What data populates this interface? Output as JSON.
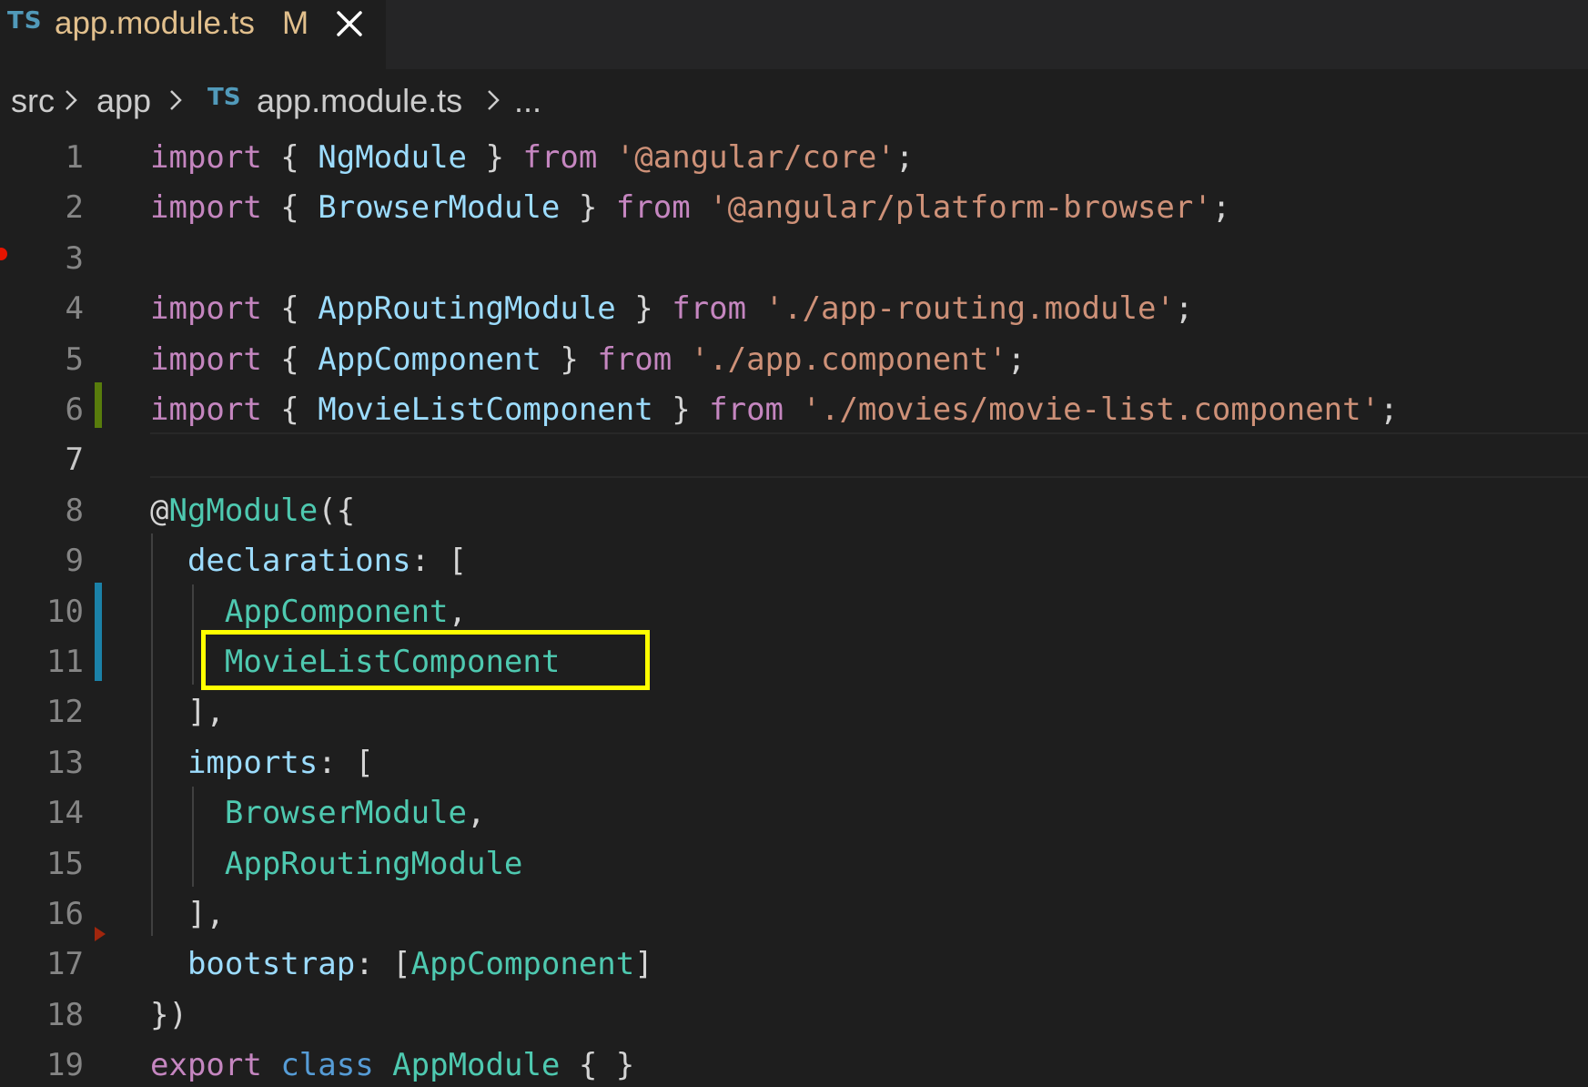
{
  "tab": {
    "icon_label": "TS",
    "filename": "app.module.ts",
    "status": "M"
  },
  "breadcrumb": {
    "items": [
      "src",
      "app",
      "app.module.ts",
      "..."
    ],
    "file_icon_label": "TS"
  },
  "editor": {
    "active_line": 7,
    "lines": [
      {
        "n": "1"
      },
      {
        "n": "2"
      },
      {
        "n": "3"
      },
      {
        "n": "4"
      },
      {
        "n": "5"
      },
      {
        "n": "6"
      },
      {
        "n": "7"
      },
      {
        "n": "8"
      },
      {
        "n": "9"
      },
      {
        "n": "10"
      },
      {
        "n": "11"
      },
      {
        "n": "12"
      },
      {
        "n": "13"
      },
      {
        "n": "14"
      },
      {
        "n": "15"
      },
      {
        "n": "16"
      },
      {
        "n": "17"
      },
      {
        "n": "18"
      },
      {
        "n": "19"
      }
    ],
    "tokens": {
      "l1": [
        "import",
        " { ",
        "NgModule",
        " } ",
        "from",
        " ",
        "'@angular/core'",
        ";"
      ],
      "l2": [
        "import",
        " { ",
        "BrowserModule",
        " } ",
        "from",
        " ",
        "'@angular/platform-browser'",
        ";"
      ],
      "l4": [
        "import",
        " { ",
        "AppRoutingModule",
        " } ",
        "from",
        " ",
        "'./app-routing.module'",
        ";"
      ],
      "l5": [
        "import",
        " { ",
        "AppComponent",
        " } ",
        "from",
        " ",
        "'./app.component'",
        ";"
      ],
      "l6": [
        "import",
        " { ",
        "MovieListComponent",
        " } ",
        "from",
        " ",
        "'./movies/movie-list.component'",
        ";"
      ],
      "l8": [
        "@",
        "NgModule",
        "({"
      ],
      "l9": [
        "  ",
        "declarations",
        ": ["
      ],
      "l10": [
        "    ",
        "AppComponent",
        ","
      ],
      "l11": [
        "    ",
        "MovieListComponent"
      ],
      "l12": [
        "  ",
        "],"
      ],
      "l13": [
        "  ",
        "imports",
        ": ["
      ],
      "l14": [
        "    ",
        "BrowserModule",
        ","
      ],
      "l15": [
        "    ",
        "AppRoutingModule"
      ],
      "l16": [
        "  ",
        "],"
      ],
      "l17": [
        "  ",
        "bootstrap",
        ": [",
        "AppComponent",
        "]"
      ],
      "l18": [
        "})"
      ],
      "l19": [
        "export",
        " ",
        "class",
        " ",
        "AppModule",
        " { }"
      ]
    }
  },
  "colors": {
    "keyword": "#c586c0",
    "string": "#ce9178",
    "variable": "#9cdcfe",
    "type": "#4ec9b0",
    "storage": "#569cd6",
    "modified_gutter": "#1b81a8",
    "added_gutter": "#587c0c",
    "highlight_box": "#ffff00",
    "tab_modified_text": "#e2c08d",
    "ts_icon": "#519aba"
  },
  "icons": {
    "tab_close": "close-icon",
    "breadcrumb_separator": "chevron-right-icon",
    "file_type": "typescript-icon"
  }
}
